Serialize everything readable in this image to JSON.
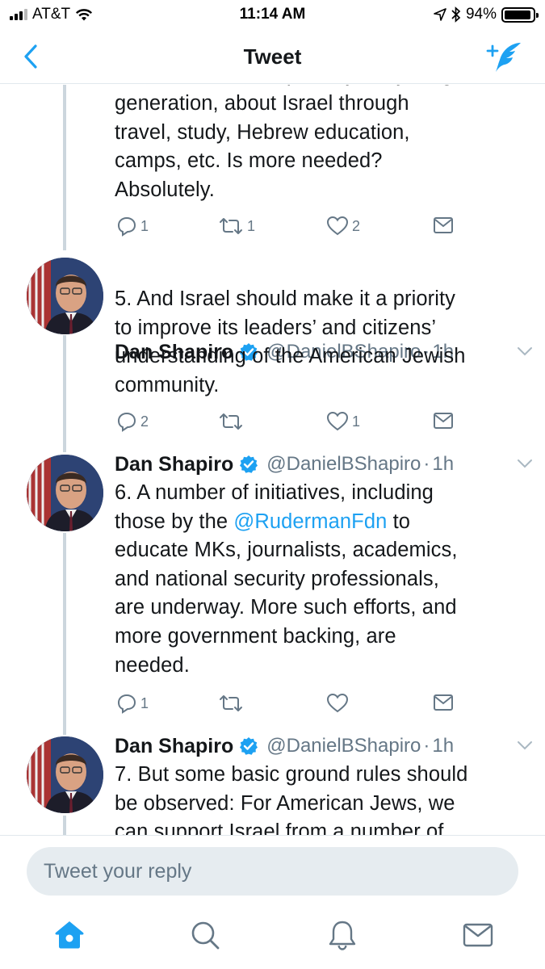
{
  "status_bar": {
    "carrier": "AT&T",
    "time": "11:14 AM",
    "battery": "94%",
    "battery_level": 0.94
  },
  "nav": {
    "title": "Tweet",
    "back_icon": "chevron-left-icon",
    "compose_icon": "compose-tweet-icon"
  },
  "tweets": [
    {
      "text_lines": [
        "generation, about Israel through",
        "travel, study, Hebrew education,",
        "camps, etc. Is more needed?",
        "Absolutely."
      ],
      "replies": "1",
      "retweets": "1",
      "likes": "2"
    },
    {
      "author": "Dan Shapiro",
      "handle": "@DanielBShapiro",
      "separator": "·",
      "time": "1h",
      "text_lines": [
        "5. And Israel should make it a priority",
        "to improve its leaders’ and citizens’",
        "understanding of the American Jewish",
        "community."
      ],
      "replies": "2",
      "retweets": "",
      "likes": "1"
    },
    {
      "author": "Dan Shapiro",
      "handle": "@DanielBShapiro",
      "separator": "·",
      "time": "1h",
      "text_line1": "6. A number of initiatives, including",
      "text_line2_pre": "those by the ",
      "text_line2_mention": "@RudermanFdn",
      "text_line2_post": " to",
      "text_lines_rest": [
        "educate MKs, journalists, academics,",
        "and national security professionals,",
        "are underway. More such efforts, and",
        "more government backing, are",
        "needed."
      ],
      "replies": "1",
      "retweets": "",
      "likes": ""
    },
    {
      "author": "Dan Shapiro",
      "handle": "@DanielBShapiro",
      "separator": "·",
      "time": "1h",
      "text_lines": [
        "7. But some basic ground rules should",
        "be observed: For American Jews, we",
        "can support Israel from a number of"
      ]
    }
  ],
  "reply": {
    "placeholder": "Tweet your reply"
  },
  "tab_bar": {
    "tabs": [
      "home-icon",
      "search-icon",
      "notifications-bell-icon",
      "messages-mail-icon"
    ],
    "active": "home-icon"
  },
  "colors": {
    "accent": "#1da1f2",
    "muted": "#657786",
    "text": "#14171a",
    "thread_line": "#ccd6dd",
    "input_bg": "#e6ecf0"
  }
}
